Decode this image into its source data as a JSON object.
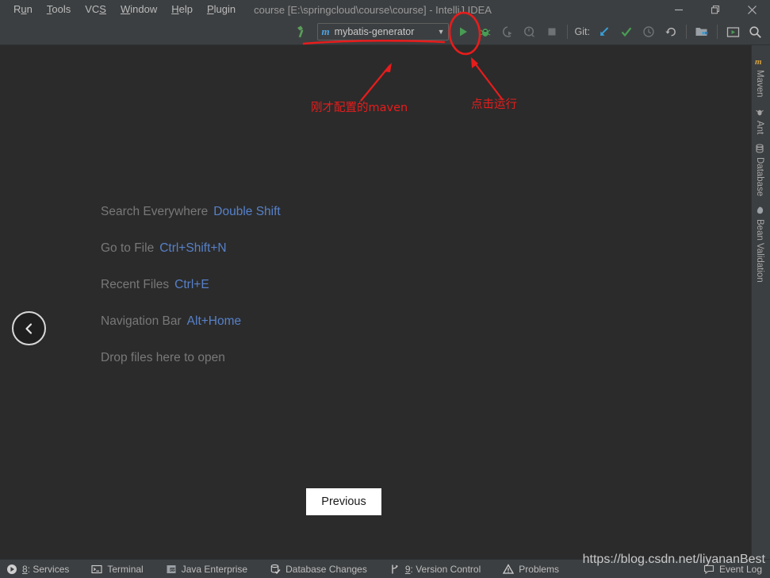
{
  "window": {
    "title": "course [E:\\springcloud\\course\\course] - IntelliJ IDEA",
    "controls": {
      "minimize": "minimize-icon",
      "restore": "restore-icon",
      "close": "close-icon"
    }
  },
  "menubar": {
    "items": [
      {
        "label": "Run",
        "pre": "R",
        "mn": "u",
        "post": "n"
      },
      {
        "label": "Tools",
        "pre": "",
        "mn": "T",
        "post": "ools"
      },
      {
        "label": "VCS",
        "pre": "VC",
        "mn": "S",
        "post": ""
      },
      {
        "label": "Window",
        "pre": "",
        "mn": "W",
        "post": "indow"
      },
      {
        "label": "Help",
        "pre": "",
        "mn": "H",
        "post": "elp"
      },
      {
        "label": "Plugin",
        "pre": "",
        "mn": "P",
        "post": "lugin"
      }
    ]
  },
  "toolbar": {
    "build_icon": "hammer-icon",
    "run_config": {
      "module_glyph": "m",
      "name": "mybatis-generator",
      "caret": "▼"
    },
    "run_icon": "run-icon",
    "debug_icon": "debug-icon",
    "coverage_icon": "run-with-coverage-icon",
    "profile_icon": "profile-icon",
    "stop_icon": "stop-icon",
    "git_label": "Git:",
    "git_update_icon": "update-project-icon",
    "git_commit_icon": "commit-icon",
    "git_history_icon": "history-icon",
    "git_rollback_icon": "rollback-icon",
    "project_structure_icon": "project-structure-icon",
    "run_anything_icon": "run-anything-icon",
    "search_icon": "search-everywhere-icon"
  },
  "editor": {
    "hints": [
      {
        "action": "Search Everywhere",
        "shortcut": "Double Shift"
      },
      {
        "action": "Go to File",
        "shortcut": "Ctrl+Shift+N"
      },
      {
        "action": "Recent Files",
        "shortcut": "Ctrl+E"
      },
      {
        "action": "Navigation Bar",
        "shortcut": "Alt+Home"
      },
      {
        "action": "Drop files here to open",
        "shortcut": ""
      }
    ],
    "collapse_button": "chevron-left-icon",
    "tooltip": "Previous"
  },
  "rightbar": {
    "items": [
      {
        "label": "Maven",
        "icon": "maven-icon"
      },
      {
        "label": "Ant",
        "icon": "ant-icon"
      },
      {
        "label": "Database",
        "icon": "database-icon"
      },
      {
        "label": "Bean Validation",
        "icon": "bean-validation-icon"
      }
    ]
  },
  "statusbar": {
    "left_items": [
      {
        "label": "8: Services",
        "mn": "8",
        "rest": ": Services",
        "icon": "services-icon"
      },
      {
        "label": "Terminal",
        "mn": "",
        "rest": "Terminal",
        "icon": "terminal-icon"
      },
      {
        "label": "Java Enterprise",
        "mn": "",
        "rest": "Java Enterprise",
        "icon": "java-enterprise-icon"
      },
      {
        "label": "Database Changes",
        "mn": "",
        "rest": "Database Changes",
        "icon": "database-changes-icon"
      },
      {
        "label": "9: Version Control",
        "mn": "9",
        "rest": ": Version Control",
        "icon": "version-control-icon"
      },
      {
        "label": "Problems",
        "mn": "",
        "rest": "Problems",
        "icon": "problems-icon"
      }
    ],
    "right_items": [
      {
        "label": "Event Log",
        "icon": "event-log-icon"
      }
    ]
  },
  "annotations": {
    "maven_note": "刚才配置的maven",
    "run_note": "点击运行",
    "color": "#e81c1c"
  },
  "watermark": {
    "text": "https://blog.csdn.net/liyananBest"
  }
}
